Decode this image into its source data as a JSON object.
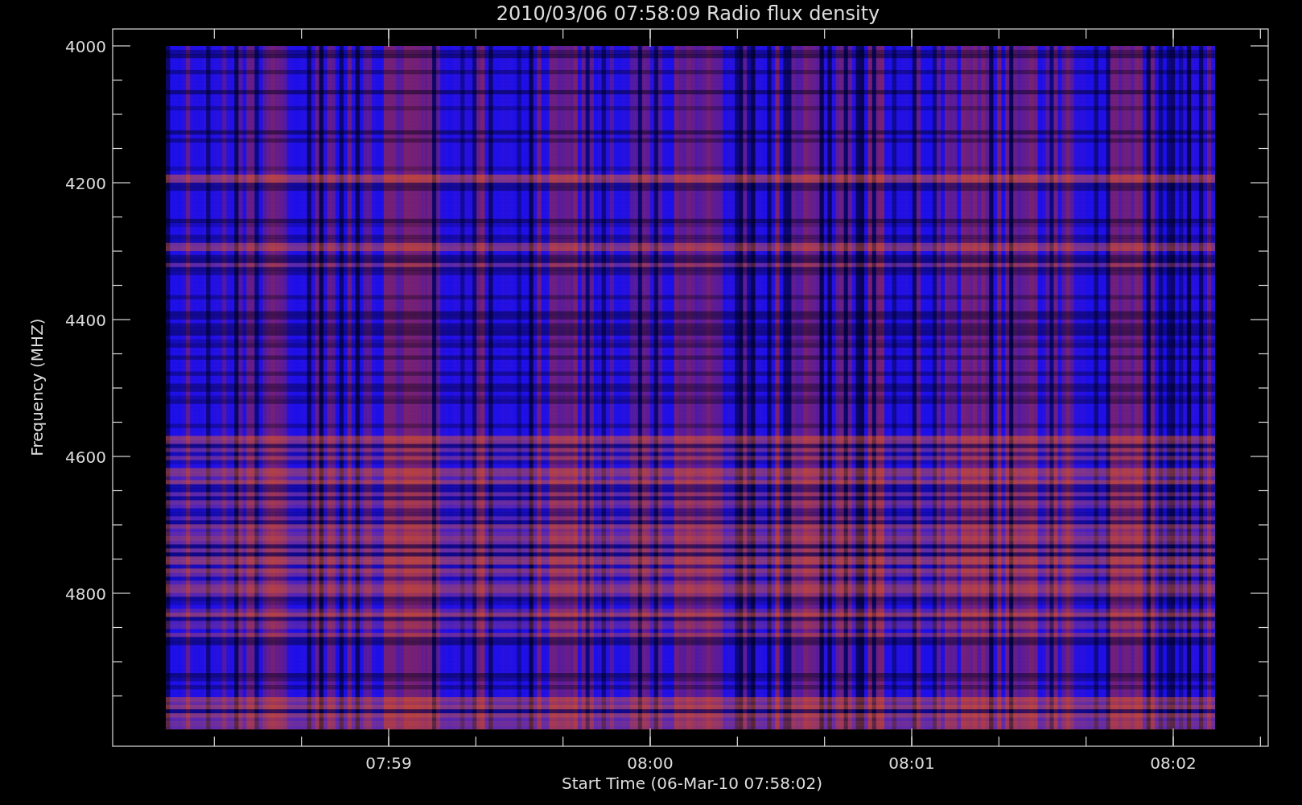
{
  "plot": {
    "title": "2010/03/06 07:58:09 Radio flux density",
    "ylabel": "Frequency (MHZ)",
    "xlabel": "Start Time (06-Mar-10 07:58:02)",
    "yticks": [
      "4000",
      "4200",
      "4400",
      "4600",
      "4800"
    ],
    "xticks": [
      "07:59",
      "08:00",
      "08:01",
      "08:02"
    ]
  }
}
